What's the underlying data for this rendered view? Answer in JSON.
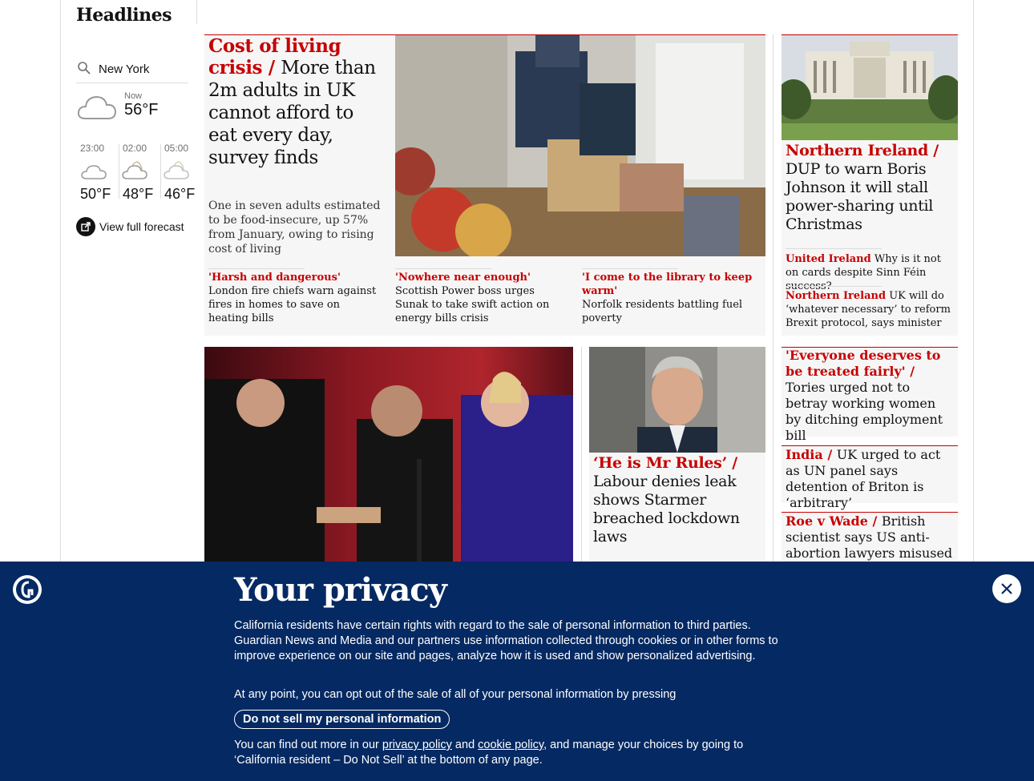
{
  "section_title": "Headlines",
  "weather": {
    "city": "New York",
    "now_label": "Now",
    "now_temp": "56°F",
    "forecast": [
      {
        "time": "23:00",
        "temp": "50°F"
      },
      {
        "time": "02:00",
        "temp": "48°F"
      },
      {
        "time": "05:00",
        "temp": "46°F"
      }
    ],
    "forecast_link": "View full forecast"
  },
  "lead": {
    "kicker": "Cost of living crisis",
    "separator": " / ",
    "headline": "More than 2m adults in UK cannot afford to eat every day, survey finds",
    "standfirst": "One in seven adults estimated to be food-insecure, up 57% from January, owing to rising cost of living",
    "sublinks": [
      {
        "kicker": "'Harsh and dangerous'",
        "text": " London fire chiefs warn against fires in homes to save on heating bills"
      },
      {
        "kicker": "'Nowhere near enough'",
        "text": " Scottish Power boss urges Sunak to take swift action on energy bills crisis"
      },
      {
        "kicker": "'I come to the library to keep warm'",
        "text": "Norfolk residents battling fuel poverty"
      }
    ]
  },
  "ni": {
    "kicker": "Northern Ireland / ",
    "headline": "DUP to warn Boris Johnson it will stall power-sharing until Christmas",
    "sublinks": [
      {
        "kicker": "United Ireland",
        "text": " Why is it not on cards despite Sinn Féin success?"
      },
      {
        "kicker": "Northern Ireland",
        "text": " UK will do ‘whatever necessary’ to reform Brexit protocol, says minister"
      }
    ]
  },
  "starmer": {
    "kicker": "‘He is Mr Rules’ / ",
    "headline": "Labour denies leak shows Starmer breached lockdown laws"
  },
  "right_stories": [
    {
      "kicker": "'Everyone deserves to be treated fairly' / ",
      "headline": "Tories urged not to betray working women by ditching employment bill"
    },
    {
      "kicker": "India  / ",
      "headline": "UK urged to act as UN panel says detention of Briton is ‘arbitrary’"
    },
    {
      "kicker": "Roe v Wade / ",
      "headline": "British scientist says US anti-abortion lawyers misused"
    }
  ],
  "privacy": {
    "title": "Your privacy",
    "para1": "California residents have certain rights with regard to the sale of personal information to third parties. Guardian News and Media and our partners use information collected through cookies or in other forms to improve experience on our site and pages, analyze how it is used and show personalized advertising.",
    "para2": "At any point, you can opt out of the sale of all of your personal information by pressing",
    "button": "Do not sell my personal information",
    "para3_a": "You can find out more in our ",
    "link1": "privacy policy",
    "para3_b": " and ",
    "link2": "cookie policy",
    "para3_c": ", and manage your choices by going to ‘California resident – Do Not Sell’ at the bottom of any page."
  },
  "colors": {
    "accent": "#c70000",
    "privacy_bg": "#052962",
    "card_bg": "#f6f6f6"
  }
}
